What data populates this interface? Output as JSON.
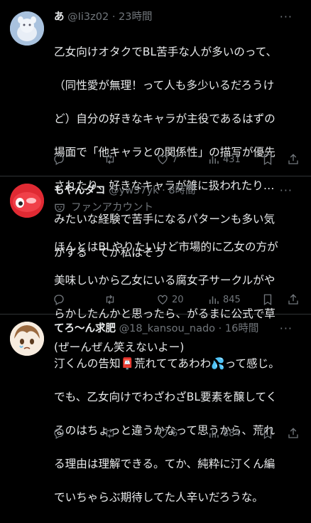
{
  "tweets": [
    {
      "name": "あ",
      "handle": "@Ii3z02",
      "time": "23時間",
      "text": "乙女向けオタクでBL苦手な人が多いのって、（同性愛が無理！って人も多少いるだろうけど）自分の好きなキャラが主役であるはずの場面で「他キャラとの関係性」の描写が優先されたり、好きなキャラが雑に扱われたり…みたいな経験で苦手になるパターンも多い気がする　てか私はそう",
      "text_lines": [
        "乙女向けオタクでBL苦手な人が多いのって、",
        "（同性愛が無理！って人も多少いるだろうけ",
        "ど）自分の好きなキャラが主役であるはずの",
        "場面で「他キャラとの関係性」の描写が優先",
        "されたり、好きなキャラが雑に扱われたり…",
        "みたいな経験で苦手になるパターンも多い気",
        "がする　てか私はそう"
      ],
      "replies": "",
      "retweets": "",
      "likes": "7",
      "views": "431"
    },
    {
      "name": "もやんダコ",
      "handle": "@yw57yk",
      "time": "8時間",
      "community": "ファンアカウント",
      "text_lines": [
        "ほんとはBLやりたいけど市場的に乙女の方が",
        "美味しいから乙女にいる腐女子サークルがや",
        "らかしたんかと思ったら、がるまに公式で草",
        "(ぜーんぜん笑えないよー)"
      ],
      "replies": "",
      "retweets": "",
      "likes": "20",
      "views": "845"
    },
    {
      "name": "てろ～ん求肥",
      "handle": "@18_kansou_nado",
      "time": "16時間",
      "text_lines": [
        "汀くんの告知📮荒れててあわわ💦って感じ。",
        "でも、乙女向けでわざわざBL要素を醸してく",
        "るのはちょっと違うかなって思うから、荒れ",
        "る理由は理解できる。てか、純粋に汀くん編",
        "でいちゃらぶ期待してた人辛いだろうな。"
      ],
      "replies": "",
      "retweets": "",
      "likes": "6",
      "views": "884"
    }
  ],
  "separator": "·",
  "more_glyph": "···"
}
